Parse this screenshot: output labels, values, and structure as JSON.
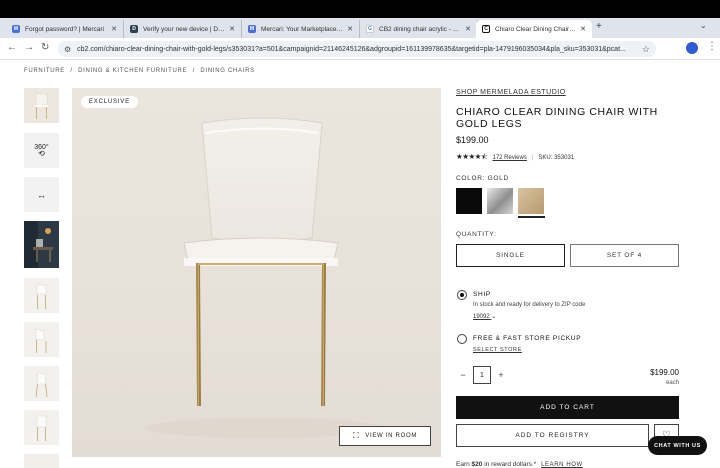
{
  "browser": {
    "tabs": [
      {
        "title": "Forgot password? | Mercari",
        "favicon_color": "#4b6ed6",
        "favicon_glyph": "M"
      },
      {
        "title": "Verify your new device | Dash",
        "favicon_color": "#2c3e50",
        "favicon_glyph": "D"
      },
      {
        "title": "Mercari: Your Marketplace | M",
        "favicon_color": "#4b6ed6",
        "favicon_glyph": "M"
      },
      {
        "title": "CB2 dining chair acrylic - Goo",
        "favicon_color": "#ffffff",
        "favicon_glyph": "G"
      },
      {
        "title": "Chiaro Clear Dining Chair with",
        "favicon_color": "#111111",
        "favicon_glyph": "C"
      }
    ],
    "url": "cb2.com/chiaro-clear-dining-chair-with-gold-legs/s353031?a=501&campaignid=21146245126&adgroupid=161139978635&targetid=pla-1479196035034&pla_sku=353031&pcat..."
  },
  "breadcrumb": [
    "FURNITURE",
    "/",
    "DINING & KITCHEN FURNITURE",
    "/",
    "DINING CHAIRS"
  ],
  "gallery": {
    "badge": "EXCLUSIVE",
    "view_in_room": "VIEW IN ROOM",
    "thumb_360": "360°"
  },
  "product": {
    "shop_link": "SHOP MERMELADA ESTUDIO",
    "title": "CHIARO CLEAR DINING CHAIR WITH GOLD LEGS",
    "price": "$199.00",
    "rating": 4.5,
    "reviews": "172 Reviews",
    "sku": "SKU: 353031",
    "color_label": "COLOR:",
    "color_value": "GOLD",
    "swatches": [
      {
        "name": "black",
        "color": "#0a0a0a"
      },
      {
        "name": "chrome",
        "color": "#b9b9b9"
      },
      {
        "name": "gold",
        "color": "#c8ad8a",
        "selected": true
      }
    ],
    "quantity_label": "QUANTITY:",
    "quantity_options": [
      "SINGLE",
      "SET OF 4"
    ],
    "ship_label": "SHIP",
    "ship_detail": "In stock and ready for delivery to ZIP code",
    "zip": "19092",
    "pickup_label": "FREE & FAST STORE PICKUP",
    "select_store": "SELECT STORE",
    "qty": "1",
    "line_price": "$199.00",
    "each": "each",
    "add_to_cart": "ADD TO CART",
    "add_to_registry": "ADD TO REGISTRY",
    "earn_prefix": "Earn",
    "earn_amount": "$20",
    "earn_suffix": "in reward dollars.*",
    "learn_how": "LEARN HOW"
  },
  "chat": "CHAT WITH US"
}
